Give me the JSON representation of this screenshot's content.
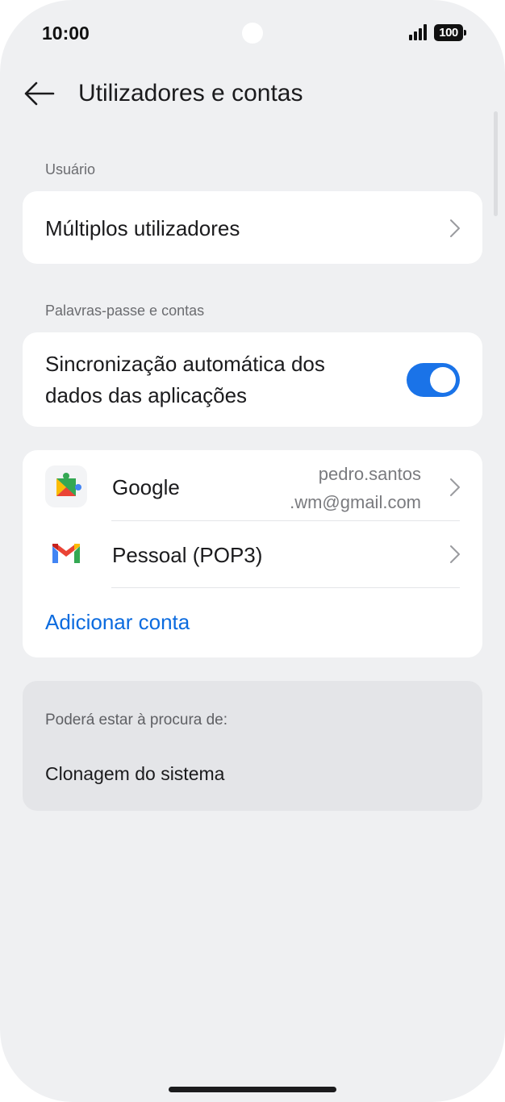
{
  "status_bar": {
    "time": "10:00",
    "battery": "100"
  },
  "header": {
    "title": "Utilizadores e contas",
    "back_icon": "arrow-left-icon"
  },
  "sections": {
    "user_label": "Usuário",
    "accounts_label": "Palavras-passe e contas"
  },
  "multiple_users": {
    "label": "Múltiplos utilizadores"
  },
  "auto_sync": {
    "label_line1": "Sincronização automática dos",
    "label_line2": "dados das aplicações",
    "enabled": true
  },
  "accounts": {
    "google": {
      "name": "Google",
      "email_line1": "pedro.santos",
      "email_line2": ".wm@gmail.com",
      "icon": "google-play-services-icon"
    },
    "personal": {
      "name": "Pessoal (POP3)",
      "icon": "gmail-icon"
    },
    "add_label": "Adicionar conta"
  },
  "suggestions": {
    "title": "Poderá estar à procura de:",
    "item": "Clonagem do sistema"
  },
  "colors": {
    "accent": "#1a73e8",
    "link": "#0b6bdf",
    "background": "#eff0f2",
    "card": "#ffffff"
  }
}
